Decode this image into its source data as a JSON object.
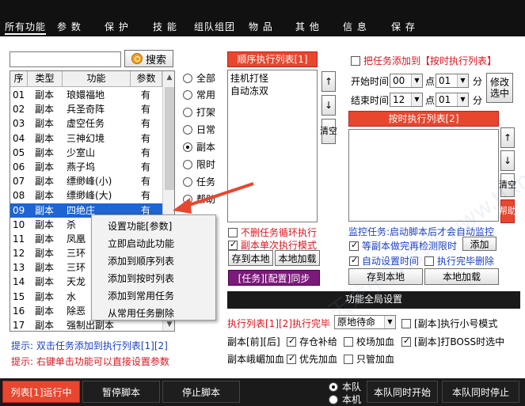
{
  "tabs": [
    "所有功能",
    "参 数",
    "保 护",
    "技 能",
    "组队组团",
    "物 品",
    "其 他",
    "信 息",
    "保 存"
  ],
  "search": {
    "value": "",
    "button_label": "搜索"
  },
  "func_list": {
    "headers": [
      "序",
      "类型",
      "功能",
      "参数"
    ],
    "rows": [
      {
        "seq": "01",
        "type": "副本",
        "func": "琅嬛福地",
        "param": "有"
      },
      {
        "seq": "02",
        "type": "副本",
        "func": "兵圣奇阵",
        "param": "有"
      },
      {
        "seq": "03",
        "type": "副本",
        "func": "虚空任务",
        "param": "有"
      },
      {
        "seq": "04",
        "type": "副本",
        "func": "三神幻境",
        "param": "有"
      },
      {
        "seq": "05",
        "type": "副本",
        "func": "少室山",
        "param": "有"
      },
      {
        "seq": "06",
        "type": "副本",
        "func": "燕子坞",
        "param": "有"
      },
      {
        "seq": "07",
        "type": "副本",
        "func": "缥缈峰(小)",
        "param": "有"
      },
      {
        "seq": "08",
        "type": "副本",
        "func": "缥缈峰(大)",
        "param": "有"
      },
      {
        "seq": "09",
        "type": "副本",
        "func": "四绝庄",
        "param": "有"
      },
      {
        "seq": "10",
        "type": "副本",
        "func": "杀",
        "param": ""
      },
      {
        "seq": "11",
        "type": "副本",
        "func": "凤凰",
        "param": ""
      },
      {
        "seq": "12",
        "type": "副本",
        "func": "三环",
        "param": ""
      },
      {
        "seq": "13",
        "type": "副本",
        "func": "三环",
        "param": ""
      },
      {
        "seq": "14",
        "type": "副本",
        "func": "天龙",
        "param": ""
      },
      {
        "seq": "15",
        "type": "副本",
        "func": "水",
        "param": ""
      },
      {
        "seq": "16",
        "type": "副本",
        "func": "除恶",
        "param": ""
      },
      {
        "seq": "17",
        "type": "副本",
        "func": "强制出副本",
        "param": ""
      }
    ]
  },
  "categories": [
    "全部",
    "常用",
    "打架",
    "日常",
    "副本",
    "限时",
    "任务",
    "帮助"
  ],
  "sequence_list": {
    "header": "顺序执行列表[1]",
    "items": [
      "挂机打怪",
      "自动冻双"
    ],
    "up": "↑",
    "down": "↓",
    "clear": "清空",
    "loop_label": "不删任务循环执行",
    "single_label": "副本单次执行模式",
    "save": "存到本地",
    "load": "本地加载",
    "sync": "[任务][配置]同步"
  },
  "timed": {
    "add_label": "把任务添加到【按时执行列表】",
    "start_label": "开始时间",
    "end_label": "结束时间",
    "start_hour": "00",
    "start_min": "01",
    "end_hour": "12",
    "end_min": "01",
    "point": "点",
    "minute": "分",
    "modify": "修改选中",
    "header": "按时执行列表[2]",
    "up": "↑",
    "down": "↓",
    "clear": "清空",
    "help": "帮助",
    "monitor": "监控任务:启动脚本后才会自动监控",
    "wait_label": "等副本做完再检测限时",
    "add": "添加",
    "auto_time": "自动设置时间",
    "delete_done": "执行完毕删除",
    "save": "存到本地",
    "load": "本地加载"
  },
  "global": {
    "header": "功能全局设置",
    "after_label": "执行列表[1][2]执行完毕",
    "after_value": "原地待命",
    "small_mode": "[副本]执行小号模式",
    "dungeon_front_back": "副本[前][后]",
    "warehouse": "存仓补给",
    "arena": "校场加血",
    "boss": "[副本]打BOSS时选中",
    "emei": "副本峨嵋加血",
    "priority": "优先加血",
    "only_heal": "只管加血"
  },
  "hints": {
    "line1": "提示: 双击任务添加到执行列表[1][2]",
    "line2": "提示: 右键单击功能可以直接设置参数"
  },
  "context_menu": [
    "设置功能[参数]",
    "立即启动此功能",
    "添加到顺序列表",
    "添加到按时列表",
    "添加到常用任务",
    "从常用任务删除"
  ],
  "bottom": {
    "run": "列表[1]运行中",
    "pause": "暂停脚本",
    "stop": "停止脚本",
    "team_label": "本队",
    "local_label": "本机",
    "team_start": "本队同时开始",
    "team_stop": "本队同时停止"
  },
  "watermark": "天龙小雷官网 www.tlxmfz.com",
  "colors": {
    "accent_red": "#e8462e",
    "select_blue": "#1e64d2",
    "hint_blue": "#1a3fc8",
    "hint_red": "#e0141e"
  }
}
